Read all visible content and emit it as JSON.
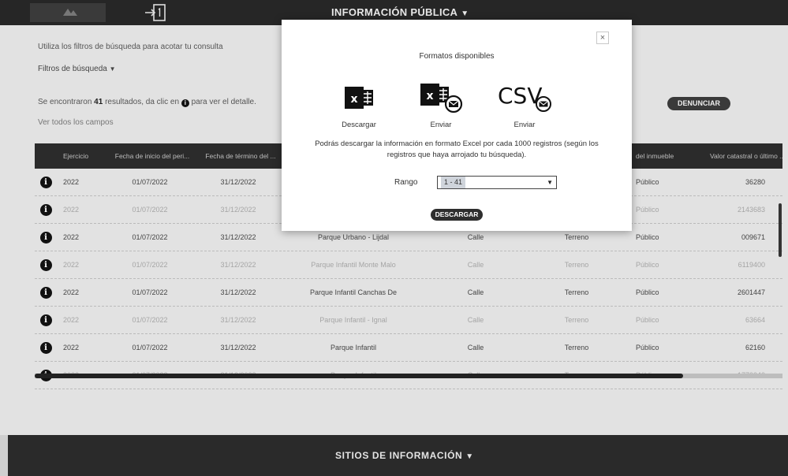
{
  "topbar": {
    "menu_label": "INFORMACIÓN PÚBLICA"
  },
  "page": {
    "hint": "Utiliza los filtros de búsqueda para acotar tu consulta",
    "filters_label": "Filtros de búsqueda",
    "results_prefix": "Se encontraron",
    "results_count": "41",
    "results_suffix": "resultados, da clic en",
    "results_end": "para ver el detalle.",
    "see_all": "Ver todos los campos",
    "report_button": "DENUNCIAR"
  },
  "table": {
    "headers": [
      "Ejercicio",
      "Fecha de inicio del peri...",
      "Fecha de término del ...",
      "",
      "",
      "",
      "del inmueble",
      "Valor catastral o último ..."
    ],
    "rows": [
      {
        "c": [
          "2022",
          "01/07/2022",
          "31/12/2022",
          "",
          "",
          "",
          "Público",
          "36280"
        ],
        "dim": false
      },
      {
        "c": [
          "2022",
          "01/07/2022",
          "31/12/2022",
          "",
          "",
          "",
          "Público",
          "2143683"
        ],
        "dim": true
      },
      {
        "c": [
          "2022",
          "01/07/2022",
          "31/12/2022",
          "Parque Urbano - Lijdal",
          "Calle",
          "Terreno",
          "Público",
          "009671"
        ],
        "dim": false
      },
      {
        "c": [
          "2022",
          "01/07/2022",
          "31/12/2022",
          "Parque Infantil Monte Malo",
          "Calle",
          "Terreno",
          "Público",
          "6119400"
        ],
        "dim": true
      },
      {
        "c": [
          "2022",
          "01/07/2022",
          "31/12/2022",
          "Parque Infantil Canchas De",
          "Calle",
          "Terreno",
          "Público",
          "2601447"
        ],
        "dim": false
      },
      {
        "c": [
          "2022",
          "01/07/2022",
          "31/12/2022",
          "Parque Infantil - Ignal",
          "Calle",
          "Terreno",
          "Público",
          "63664"
        ],
        "dim": true
      },
      {
        "c": [
          "2022",
          "01/07/2022",
          "31/12/2022",
          "Parque Infantil",
          "Calle",
          "Terreno",
          "Público",
          "62160"
        ],
        "dim": false
      },
      {
        "c": [
          "2022",
          "01/07/2022",
          "31/12/2022",
          "Parque Infantil",
          "Calle",
          "Terreno",
          "Público",
          "1770040"
        ],
        "dim": true
      }
    ]
  },
  "footer": {
    "menu_label": "SITIOS DE INFORMACIÓN"
  },
  "modal": {
    "close": "×",
    "title": "Formatos disponibles",
    "options": [
      {
        "label": "Descargar",
        "icon": "excel-icon"
      },
      {
        "label": "Enviar",
        "icon": "excel-mail-icon"
      },
      {
        "label": "Enviar",
        "icon": "csv-mail-icon"
      }
    ],
    "csv_text": "CSV",
    "description": "Podrás descargar la información en formato Excel por cada 1000 registros (según los registros que haya arrojado tu búsqueda).",
    "range_label": "Rango",
    "range_value": "1 - 41",
    "download_button": "DESCARGAR"
  },
  "colors": {
    "dark": "#2b2b2b",
    "modal_bg": "#ffffff",
    "page_bg": "#e2e2e2"
  }
}
